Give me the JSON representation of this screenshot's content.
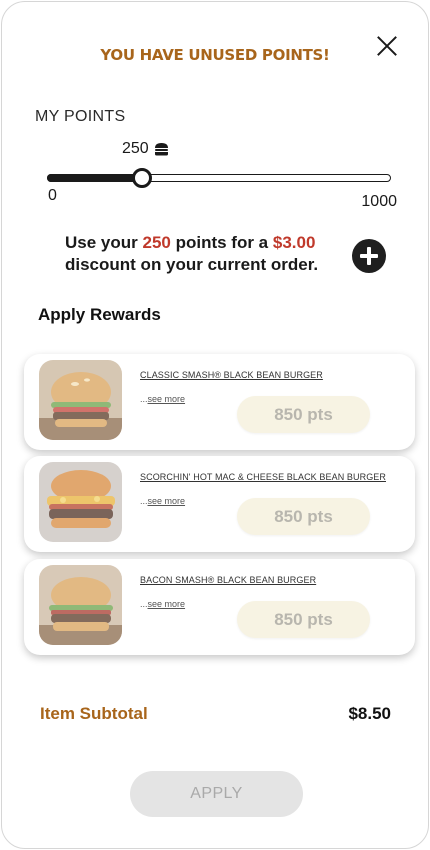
{
  "header": {
    "title": "YOU HAVE UNUSED POINTS!",
    "close_icon": "close-icon"
  },
  "points": {
    "label": "MY POINTS",
    "current_display": "250",
    "current": 250,
    "min": "0",
    "max": "1000",
    "min_value": 0,
    "max_value": 1000,
    "unit_icon": "burger-icon"
  },
  "discount": {
    "prefix": "Use your ",
    "points": "250",
    "middle": " points for a ",
    "amount": "$3.00",
    "suffix": " discount on your current order.",
    "add_icon": "plus-circle-icon"
  },
  "rewards": {
    "title": "Apply Rewards",
    "see_more_prefix": "...",
    "items": [
      {
        "name": "CLASSIC SMASH® BLACK BEAN BURGER",
        "see_more": "see more",
        "points": "850 pts"
      },
      {
        "name": "SCORCHIN' HOT MAC & CHEESE BLACK BEAN BURGER",
        "see_more": "see more",
        "points": "850 pts"
      },
      {
        "name": "BACON SMASH® BLACK BEAN BURGER",
        "see_more": "see more",
        "points": "850 pts"
      }
    ]
  },
  "subtotal": {
    "label": "Item Subtotal",
    "value": "$8.50"
  },
  "apply_button": "APPLY",
  "colors": {
    "accent": "#a8651b",
    "highlight": "#c0392b",
    "points_button_bg": "#f7f3e3",
    "disabled_button_bg": "#e4e4e4"
  }
}
